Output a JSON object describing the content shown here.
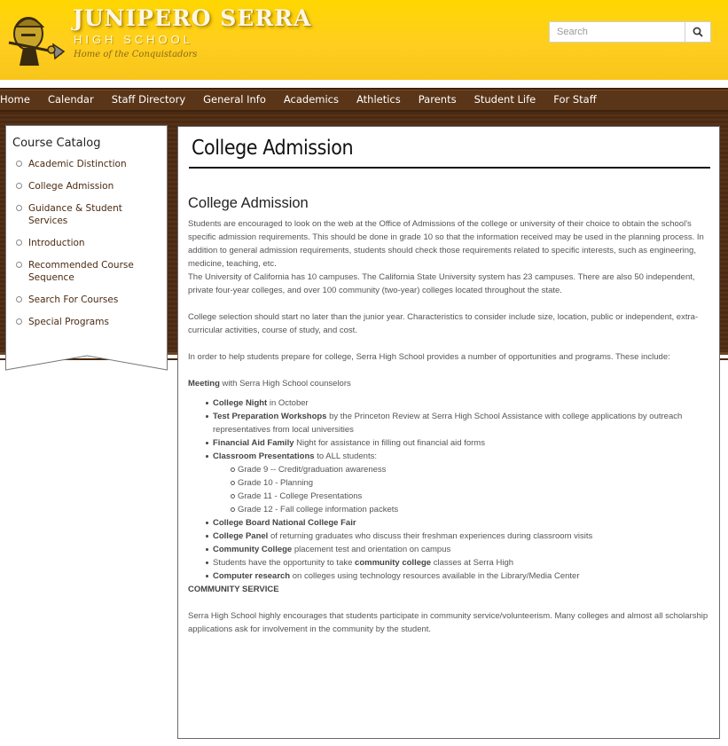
{
  "header": {
    "school_name": "JUNIPERO SERRA",
    "school_sub": "HIGH SCHOOL",
    "tagline": "Home of the Conquistadors",
    "search_placeholder": "Search",
    "colors": {
      "header_gold": "#ffd21f",
      "nav_brown": "#5a3518"
    }
  },
  "nav": {
    "items": [
      "Home",
      "Calendar",
      "Staff Directory",
      "General Info",
      "Academics",
      "Athletics",
      "Parents",
      "Student Life",
      "For Staff"
    ]
  },
  "sidebar": {
    "title": "Course Catalog",
    "items": [
      "Academic Distinction",
      "College Admission",
      "Guidance & Student Services",
      "Introduction",
      "Recommended Course Sequence",
      "Search For Courses",
      "Special Programs"
    ]
  },
  "main": {
    "page_title": "College Admission",
    "heading": "College Admission",
    "para1": "Students are encouraged to look on the web at the Office of Admissions of the college or university of their choice to obtain the school's specific admission requirements.  This should be done in grade 10 so that the information received may be used in the planning process.  In addition to general admission requirements, students should check those requirements related to specific interests, such as engineering, medicine, teaching, etc.",
    "para2": "The University of California has 10 campuses.  The California State University system has 23 campuses. There are also 50 independent, private four-year colleges, and over 100 community (two-year) colleges located throughout the state.",
    "para3": "College selection should start no later than the junior year. Characteristics to consider include size, location, public or independent, extra-curricular activities, course of study, and cost.",
    "para4": "In order to help students prepare for college, Serra High School provides a number of opportunities and programs. These include:",
    "meeting_bold": "Meeting",
    "meeting_rest": " with Serra High School counselors",
    "list": {
      "college_night_bold": "College Night",
      "college_night_rest": " in October",
      "test_prep_bold": "Test Preparation Workshops",
      "test_prep_rest": " by the Princeton Review at Serra High School Assistance with college applications by outreach representatives from local universities",
      "financial_bold": "Financial Aid Family",
      "financial_rest": " Night for assistance in filling out financial aid forms",
      "classroom_bold": "Classroom Presentations",
      "classroom_rest": " to ALL students:",
      "grades": [
        "Grade  9 --   Credit/graduation awareness",
        "Grade 10 -  Planning",
        "Grade 11 -  College Presentations",
        "Grade 12 -  Fall college information packets"
      ],
      "board_fair_bold": "College Board National College Fair",
      "panel_bold": "College Panel",
      "panel_rest": " of returning graduates who discuss their freshman experiences during classroom visits",
      "cc_bold": "Community College",
      "cc_rest": " placement test and orientation on campus",
      "students_pre": "Students have the opportunity to take ",
      "students_bold": "community college",
      "students_post": " classes at Serra High",
      "computer_bold": "Computer research",
      "computer_rest": " on colleges using technology resources available in the Library/Media Center"
    },
    "community_heading": "COMMUNITY SERVICE",
    "community_para": "Serra High School highly encourages that students participate in community service/volunteerism.  Many colleges and almost all scholarship applications ask for involvement in the community by the student."
  }
}
